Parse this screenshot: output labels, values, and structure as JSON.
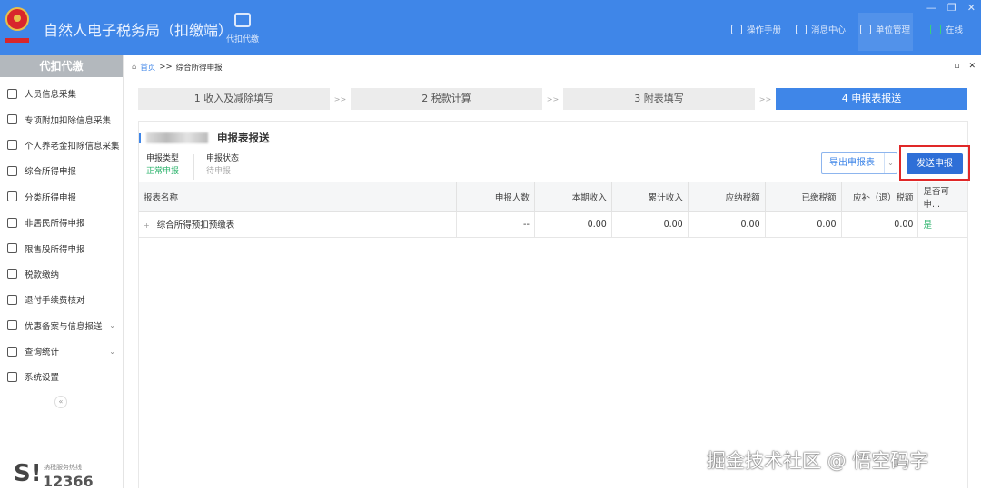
{
  "header": {
    "title": "自然人电子税务局（扣缴端）",
    "nav": "代扣代缴",
    "links": [
      "操作手册",
      "消息中心",
      "单位管理",
      "在线"
    ],
    "window_controls": [
      "—",
      "❐",
      "✕"
    ]
  },
  "sidebar": {
    "title": "代扣代缴",
    "items": [
      {
        "label": "人员信息采集"
      },
      {
        "label": "专项附加扣除信息采集"
      },
      {
        "label": "个人养老金扣除信息采集"
      },
      {
        "label": "综合所得申报"
      },
      {
        "label": "分类所得申报"
      },
      {
        "label": "非居民所得申报"
      },
      {
        "label": "限售股所得申报"
      },
      {
        "label": "税款缴纳"
      },
      {
        "label": "退付手续费核对"
      },
      {
        "label": "优惠备案与信息报送",
        "expandable": true
      },
      {
        "label": "查询统计",
        "expandable": true
      },
      {
        "label": "系统设置"
      }
    ],
    "collapse": "«",
    "hotline_label": "纳税服务热线",
    "hotline_number": "12366"
  },
  "breadcrumb": {
    "home": "首页",
    "sep": ">>",
    "current": "综合所得申报"
  },
  "tab_controls": [
    "▫",
    "✕"
  ],
  "steps": [
    {
      "label": "1 收入及减除填写"
    },
    {
      "label": "2 税款计算"
    },
    {
      "label": "3 附表填写"
    },
    {
      "label": "4 申报表报送",
      "active": true
    }
  ],
  "step_sep": ">>",
  "card": {
    "title": "申报表报送",
    "type_label": "申报类型",
    "type_value": "正常申报",
    "status_label": "申报状态",
    "status_value": "待申报",
    "export_button": "导出申报表",
    "send_button": "发送申报"
  },
  "table": {
    "headers": [
      "报表名称",
      "申报人数",
      "本期收入",
      "累计收入",
      "应纳税额",
      "已缴税额",
      "应补（退）税额",
      "是否可申..."
    ],
    "rows": [
      [
        "综合所得预扣预缴表",
        "--",
        "0.00",
        "0.00",
        "0.00",
        "0.00",
        "0.00",
        "是"
      ]
    ]
  },
  "watermark": "掘金技术社区 @ 悟空码字"
}
